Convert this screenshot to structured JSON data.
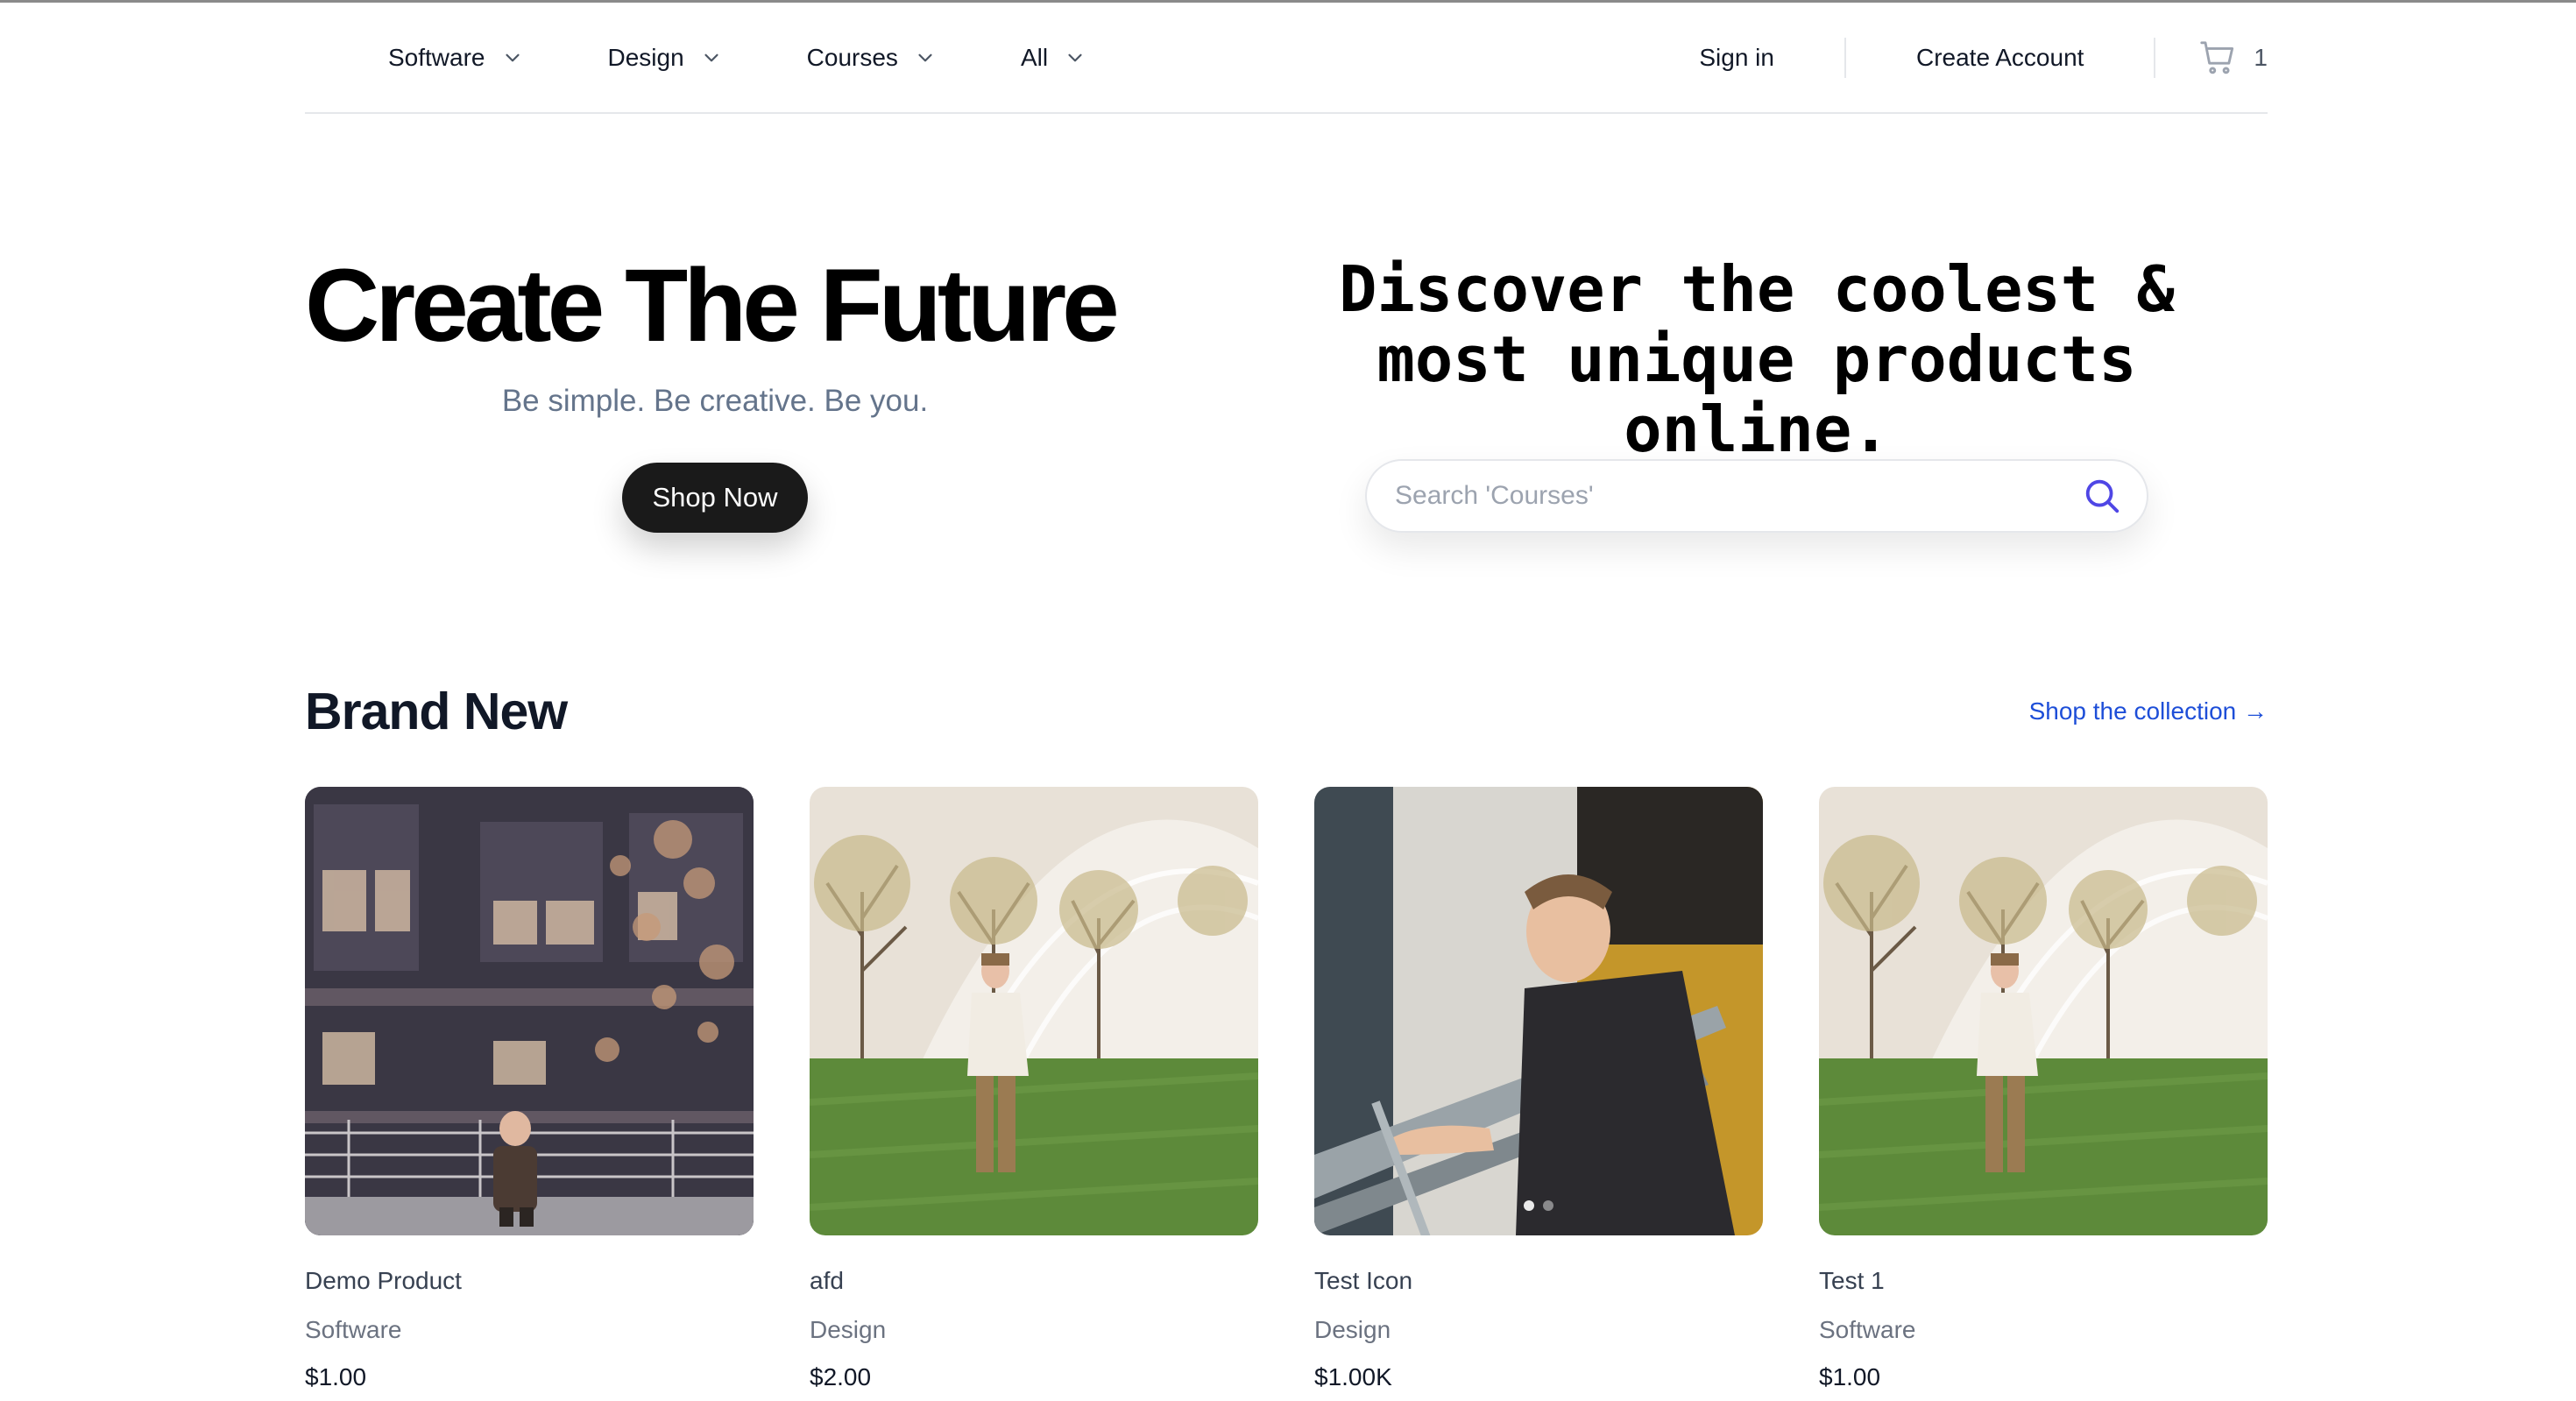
{
  "nav": {
    "menus": [
      {
        "label": "Software"
      },
      {
        "label": "Design"
      },
      {
        "label": "Courses"
      },
      {
        "label": "All"
      }
    ],
    "sign_in": "Sign in",
    "create_account": "Create Account",
    "cart_count": "1"
  },
  "hero": {
    "title": "Create The Future",
    "subtitle": "Be simple. Be creative. Be you.",
    "cta": "Shop Now",
    "tagline_line1": "Discover the coolest &",
    "tagline_line2": "most unique products online.",
    "search_placeholder": "Search 'Courses'"
  },
  "section": {
    "title": "Brand New",
    "link": "Shop the collection →"
  },
  "products": [
    {
      "name": "Demo Product",
      "category": "Software",
      "price": "$1.00"
    },
    {
      "name": "afd",
      "category": "Design",
      "price": "$2.00"
    },
    {
      "name": "Test Icon",
      "category": "Design",
      "price": "$1.00K"
    },
    {
      "name": "Test 1",
      "category": "Software",
      "price": "$1.00"
    }
  ],
  "colors": {
    "accent": "#1d4ed8",
    "search_icon": "#4f46e5",
    "cta_bg": "#1a1a1a"
  },
  "icons": {
    "menu_chevron": "chevron-down-icon",
    "cart": "shopping-cart-icon",
    "search": "search-icon"
  }
}
